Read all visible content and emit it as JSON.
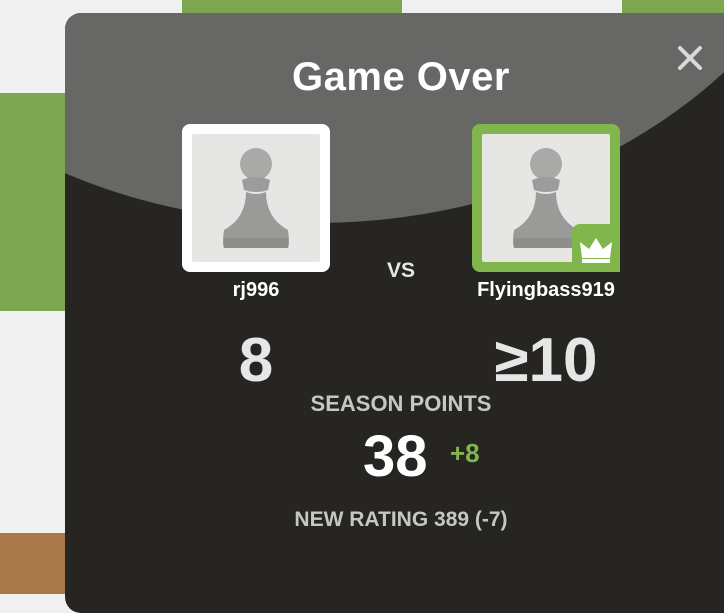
{
  "modal": {
    "title": "Game Over",
    "close_label": "×"
  },
  "players": {
    "left": {
      "name": "rj996",
      "score": "8",
      "avatar_icon": "pawn-icon"
    },
    "vs_label": "VS",
    "right": {
      "name": "Flyingbass919",
      "score": "≥10",
      "avatar_icon": "pawn-icon",
      "badge_icon": "crown-icon"
    }
  },
  "season": {
    "label": "SEASON POINTS",
    "points": "38",
    "delta": "+8"
  },
  "rating": {
    "text": "NEW RATING 389 (-7)"
  },
  "colors": {
    "accent_green": "#81b64c",
    "modal_bg": "#262522",
    "header_bg": "#676765",
    "board_light": "#f0f0f0",
    "board_dark": "#7ca64f"
  }
}
